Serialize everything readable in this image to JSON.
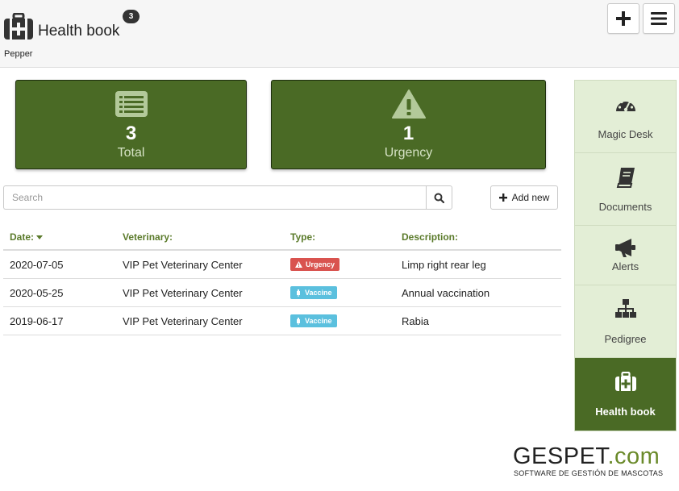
{
  "header": {
    "title": "Health book",
    "badge_count": "3",
    "subtitle": "Pepper",
    "add_icon": "plus-icon",
    "menu_icon": "hamburger-menu-icon"
  },
  "stats": {
    "total": {
      "count": "3",
      "label": "Total",
      "icon": "list-icon"
    },
    "urgency": {
      "count": "1",
      "label": "Urgency",
      "icon": "warning-icon"
    }
  },
  "search": {
    "placeholder": "Search",
    "value": "",
    "icon": "search-icon"
  },
  "add_new": {
    "label": "Add new",
    "icon": "plus-icon"
  },
  "table": {
    "columns": {
      "date": "Date:",
      "veterinary": "Veterinary:",
      "type": "Type:",
      "description": "Description:"
    },
    "rows": [
      {
        "date": "2020-07-05",
        "veterinary": "VIP Pet Veterinary Center",
        "type": "Urgency",
        "type_icon": "warning-icon",
        "description": "Limp right rear leg"
      },
      {
        "date": "2020-05-25",
        "veterinary": "VIP Pet Veterinary Center",
        "type": "Vaccine",
        "type_icon": "syringe-icon",
        "description": "Annual vaccination"
      },
      {
        "date": "2019-06-17",
        "veterinary": "VIP Pet Veterinary Center",
        "type": "Vaccine",
        "type_icon": "syringe-icon",
        "description": "Rabia"
      }
    ]
  },
  "sidebar": {
    "items": [
      {
        "label": "Magic Desk",
        "icon": "dashboard-icon",
        "active": false
      },
      {
        "label": "Documents",
        "icon": "book-icon",
        "active": false
      },
      {
        "label": "Alerts",
        "icon": "megaphone-icon",
        "active": false
      },
      {
        "label": "Pedigree",
        "icon": "sitemap-icon",
        "active": false
      },
      {
        "label": "Health book",
        "icon": "medkit-icon",
        "active": true
      }
    ]
  },
  "brand": {
    "name_main": "GESPET",
    "name_suffix": ".com",
    "tagline": "SOFTWARE DE GESTIÓN DE MASCOTAS"
  },
  "colors": {
    "primary_green": "#4a6a25",
    "sidebar_bg": "#e3eed6",
    "header_green_text": "#5a7a2a",
    "urgency_red": "#d9534f",
    "vaccine_blue": "#5bc0de"
  }
}
